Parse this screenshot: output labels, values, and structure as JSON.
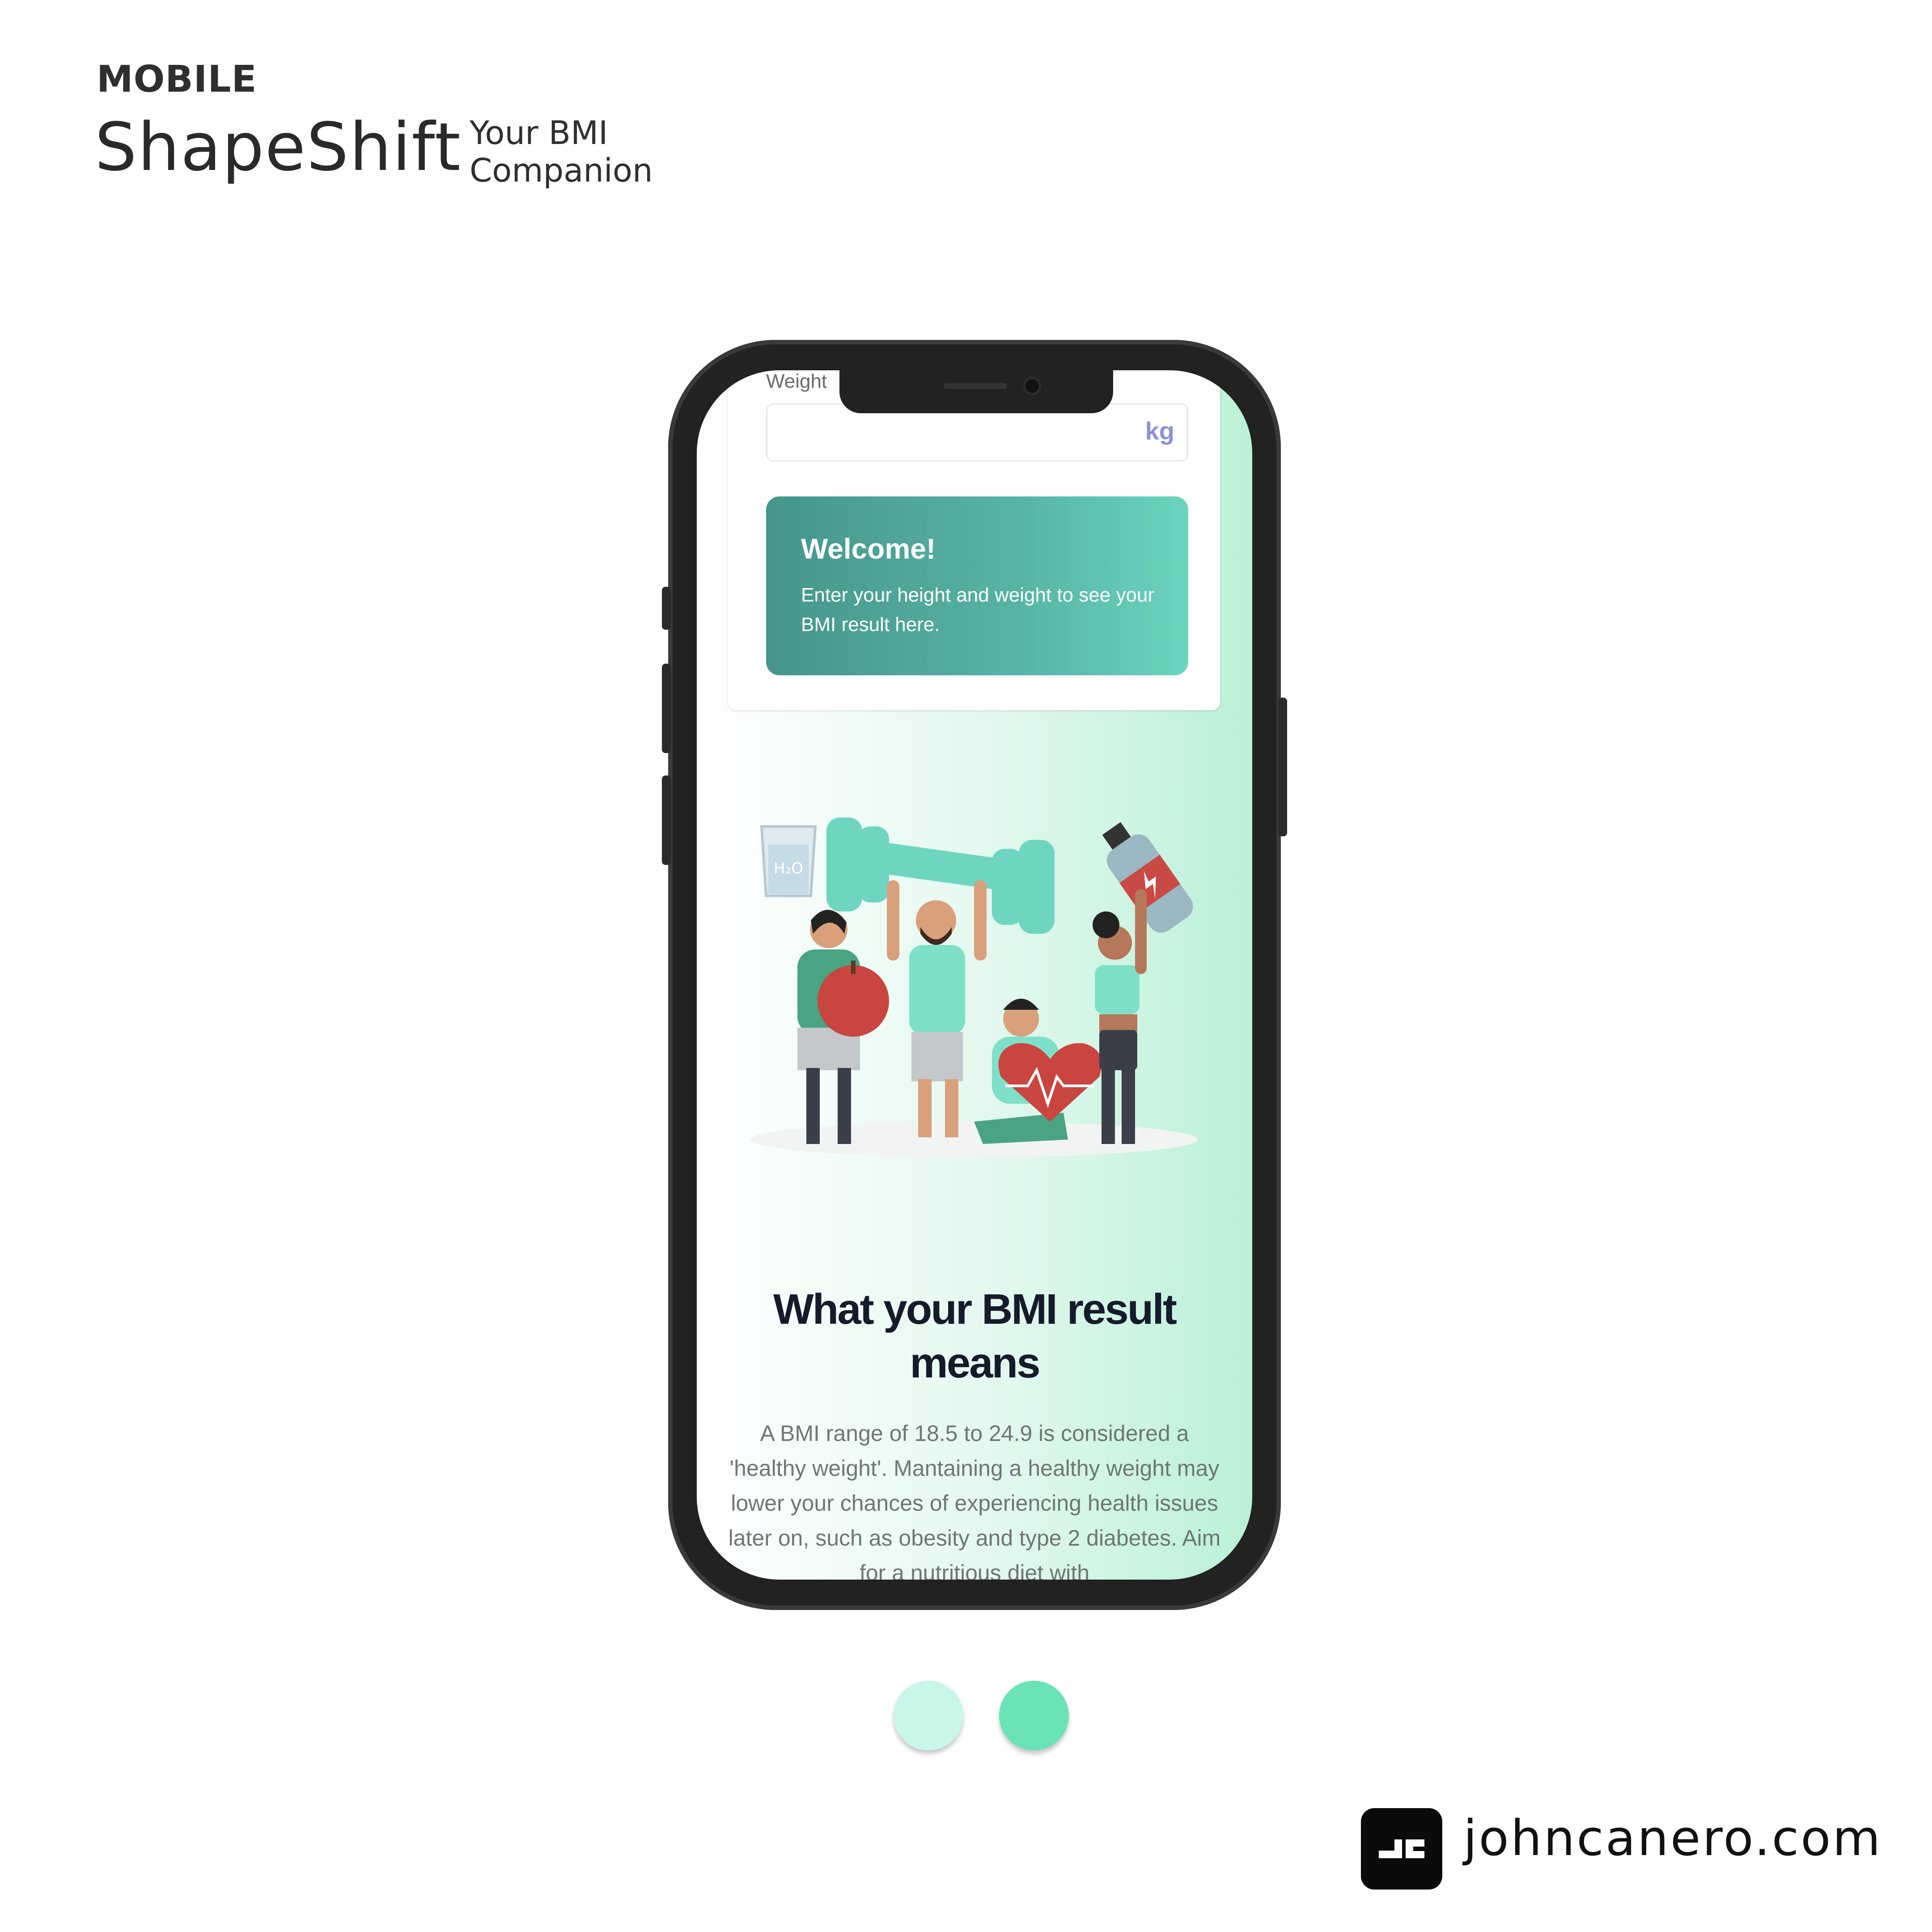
{
  "header": {
    "category": "MOBILE",
    "brand": "ShapeShift",
    "tagline_line1": "Your BMI",
    "tagline_line2": "Companion"
  },
  "app": {
    "weight_label": "Weight",
    "weight_unit": "kg",
    "welcome": {
      "title": "Welcome!",
      "body": "Enter your height and weight to see your BMI result here."
    },
    "info": {
      "heading": "What your BMI result means",
      "paragraph": "A BMI range of 18.5 to 24.9 is considered a 'healthy weight'. Mantaining a healthy weight may lower your chances of experiencing health issues later on, such as obesity and type 2 diabetes. Aim for a nutritious diet with"
    },
    "illustration_text": "H₂O"
  },
  "palette": {
    "swatch1": "#c8f7ea",
    "swatch2": "#6ae4b7"
  },
  "footer": {
    "website": "johncanero.com"
  }
}
